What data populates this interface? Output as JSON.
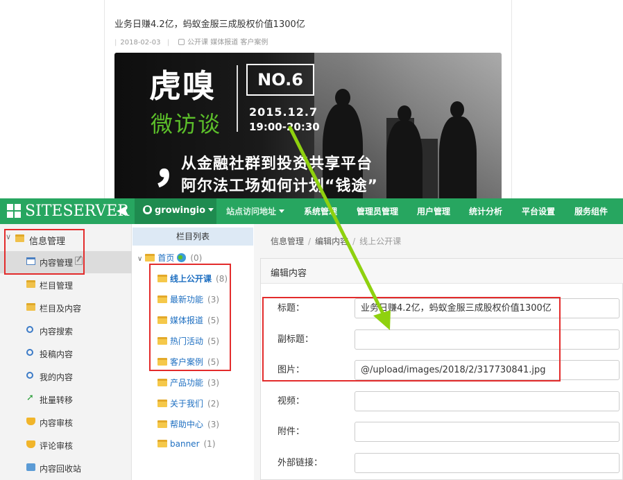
{
  "article": {
    "title": "业务日赚4.2亿，蚂蚁金服三成股权价值1300亿",
    "date": "2018-02-03",
    "tags": "公开课 媒体报道 客户案例",
    "banner": {
      "brand": "虎嗅",
      "subtitle": "微访谈",
      "episode": "NO.6",
      "date": "2015.12.7",
      "time": "19:00-20:30",
      "quote_mark": "，",
      "line1": "从金融社群到投资共享平台",
      "line2": "阿尔法工场如何计划“钱途”"
    }
  },
  "cms": {
    "logo": "SITESERVER",
    "site_selector": "growingio",
    "nav": [
      "站点访问地址",
      "系统管理",
      "管理员管理",
      "用户管理",
      "统计分析",
      "平台设置",
      "服务组件"
    ],
    "sidebar": {
      "section": "信息管理",
      "items": [
        "内容管理",
        "栏目管理",
        "栏目及内容",
        "内容搜索",
        "投稿内容",
        "我的内容",
        "批量转移",
        "内容审核",
        "评论审核",
        "内容回收站"
      ]
    },
    "tree": {
      "header": "栏目列表",
      "root": {
        "name": "首页",
        "count": "(0)"
      },
      "nodes": [
        {
          "name": "线上公开课",
          "count": "(8)"
        },
        {
          "name": "最新功能",
          "count": "(3)"
        },
        {
          "name": "媒体报道",
          "count": "(5)"
        },
        {
          "name": "热门活动",
          "count": "(5)"
        },
        {
          "name": "客户案例",
          "count": "(5)"
        },
        {
          "name": "产品功能",
          "count": "(3)"
        },
        {
          "name": "关于我们",
          "count": "(2)"
        },
        {
          "name": "帮助中心",
          "count": "(3)"
        },
        {
          "name": "banner",
          "count": "(1)"
        }
      ]
    },
    "breadcrumb": [
      "信息管理",
      "编辑内容",
      "线上公开课"
    ],
    "panel_title": "编辑内容",
    "form": {
      "title_label": "标题：",
      "title_value": "业务日赚4.2亿，蚂蚁金服三成股权价值1300亿",
      "subtitle_label": "副标题：",
      "subtitle_value": "",
      "image_label": "图片：",
      "image_value": "@/upload/images/2018/2/317730841.jpg",
      "video_label": "视频：",
      "video_value": "",
      "attachment_label": "附件：",
      "attachment_value": "",
      "link_label": "外部链接：",
      "link_value": ""
    }
  },
  "colors": {
    "topbar": "#27a660",
    "highlight": "#e32b2b",
    "arrow": "#8fd10f"
  }
}
